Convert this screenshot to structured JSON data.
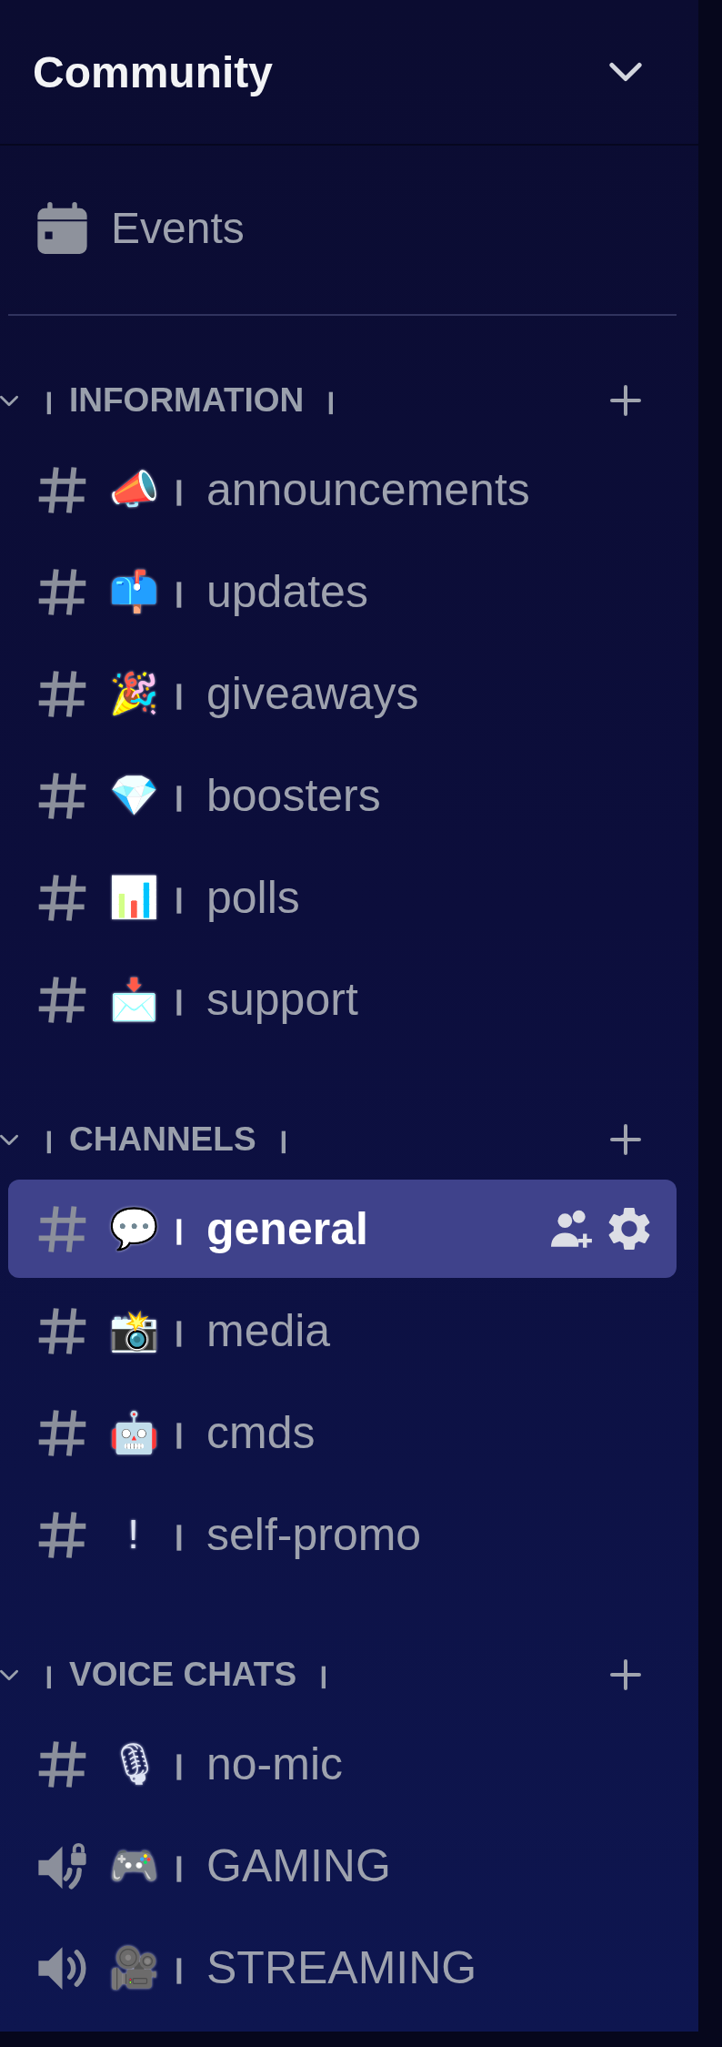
{
  "server": {
    "name": "Community"
  },
  "events": {
    "label": "Events"
  },
  "categories": [
    {
      "prefix": "ㅣ",
      "name": "INFORMATION",
      "suffix": "ㅣ",
      "expanded": true,
      "channels": [
        {
          "kind": "text",
          "emoji": "📣",
          "separator": "ㅣ",
          "name": "announcements",
          "selected": false
        },
        {
          "kind": "text",
          "emoji": "📫",
          "separator": "ㅣ",
          "name": "updates",
          "selected": false
        },
        {
          "kind": "text",
          "emoji": "🎉",
          "separator": "ㅣ",
          "name": "giveaways",
          "selected": false
        },
        {
          "kind": "text",
          "emoji": "💎",
          "separator": "ㅣ",
          "name": "boosters",
          "selected": false
        },
        {
          "kind": "text",
          "emoji": "📊",
          "separator": "ㅣ",
          "name": "polls",
          "selected": false
        },
        {
          "kind": "text",
          "emoji": "📩",
          "separator": "ㅣ",
          "name": "support",
          "selected": false
        }
      ]
    },
    {
      "prefix": "ㅣ",
      "name": "CHANNELS",
      "suffix": "ㅣ",
      "expanded": true,
      "channels": [
        {
          "kind": "text",
          "emoji": "💬",
          "separator": "ㅣ",
          "name": "general",
          "selected": true
        },
        {
          "kind": "text",
          "emoji": "📸",
          "separator": "ㅣ",
          "name": "media",
          "selected": false
        },
        {
          "kind": "text",
          "emoji": "🤖",
          "separator": "ㅣ",
          "name": "cmds",
          "selected": false
        },
        {
          "kind": "text",
          "emoji": "!",
          "separator": "ㅣ",
          "name": "self-promo",
          "selected": false
        }
      ]
    },
    {
      "prefix": "ㅣ",
      "name": "VOICE CHATS",
      "suffix": "ㅣ",
      "expanded": true,
      "channels": [
        {
          "kind": "text",
          "emoji": "🎙",
          "separator": "ㅣ",
          "name": "no-mic",
          "selected": false
        },
        {
          "kind": "voice_locked",
          "emoji": "🎮",
          "separator": "ㅣ",
          "name": "GAMING",
          "selected": false
        },
        {
          "kind": "voice",
          "emoji": "🎥",
          "separator": "ㅣ",
          "name": "STREAMING",
          "selected": false
        }
      ]
    }
  ]
}
